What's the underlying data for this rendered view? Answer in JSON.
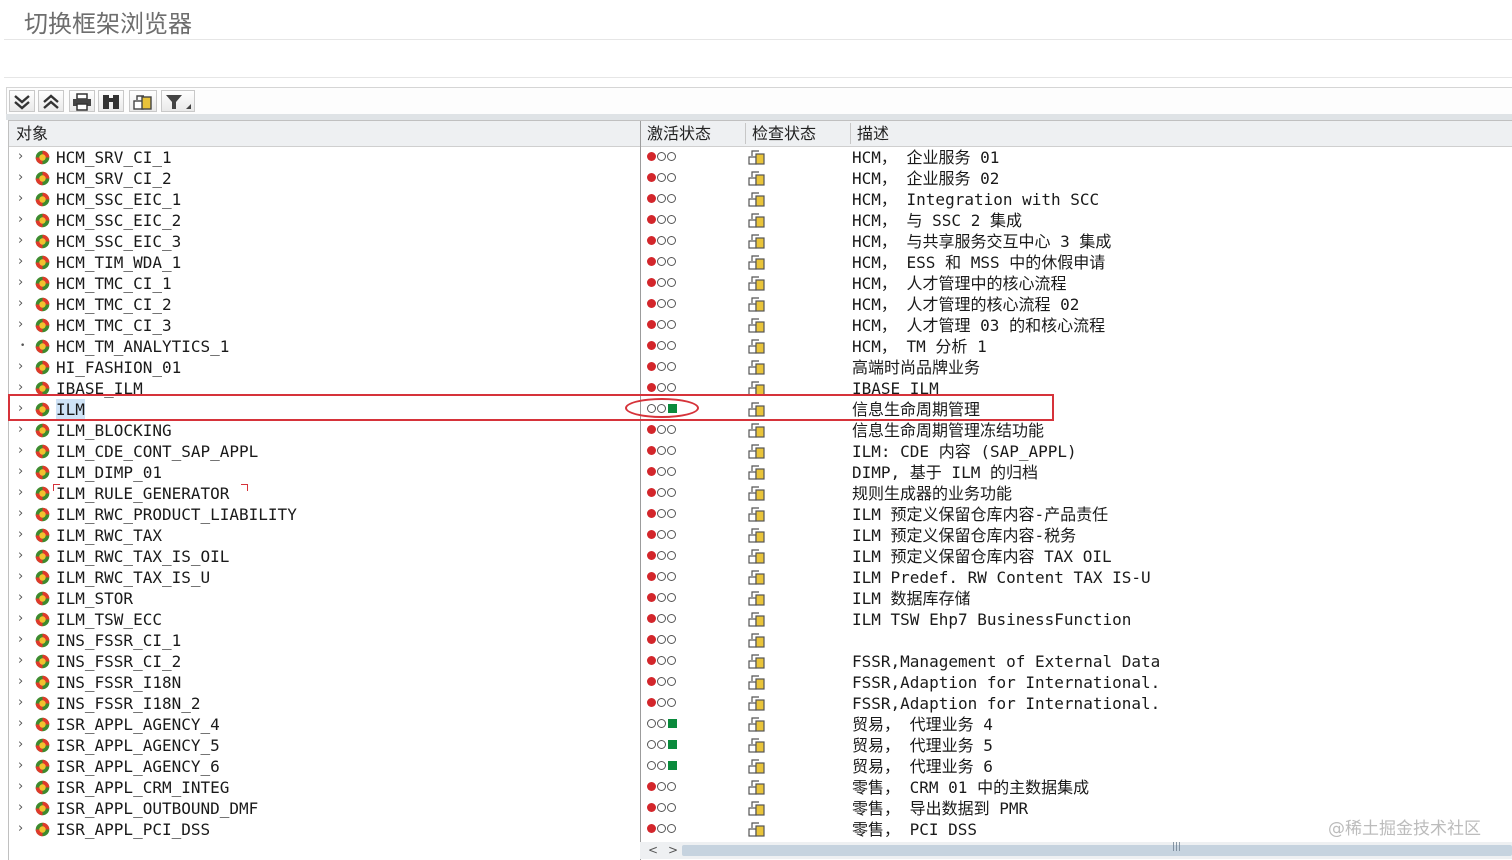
{
  "window": {
    "title": "切换框架浏览器"
  },
  "toolbar": {
    "buttons": [
      "expand-all-icon",
      "collapse-all-icon",
      "print-icon",
      "find-icon",
      "transport-icon",
      "filter-icon"
    ]
  },
  "columns": {
    "object": "对象",
    "activation": "激活状态",
    "check": "检查状态",
    "description": "描述"
  },
  "colors": {
    "inactive_red": "#d3262b",
    "active_green": "#0a8a3c",
    "highlight": "#d6333a",
    "selection": "#cfe3f6"
  },
  "rows": [
    {
      "name": "HCM_SRV_CI_1",
      "desc": "HCM， 企业服务 01",
      "active": false
    },
    {
      "name": "HCM_SRV_CI_2",
      "desc": "HCM， 企业服务 02",
      "active": false
    },
    {
      "name": "HCM_SSC_EIC_1",
      "desc": "HCM， Integration with SCC",
      "active": false
    },
    {
      "name": "HCM_SSC_EIC_2",
      "desc": "HCM， 与 SSC 2 集成",
      "active": false
    },
    {
      "name": "HCM_SSC_EIC_3",
      "desc": "HCM， 与共享服务交互中心 3 集成",
      "active": false
    },
    {
      "name": "HCM_TIM_WDA_1",
      "desc": "HCM， ESS 和 MSS 中的休假申请",
      "active": false
    },
    {
      "name": "HCM_TMC_CI_1",
      "desc": "HCM， 人才管理中的核心流程",
      "active": false
    },
    {
      "name": "HCM_TMC_CI_2",
      "desc": "HCM， 人才管理的核心流程 02",
      "active": false
    },
    {
      "name": "HCM_TMC_CI_3",
      "desc": "HCM， 人才管理 03 的和核心流程",
      "active": false
    },
    {
      "name": "HCM_TM_ANALYTICS_1",
      "desc": "HCM， TM 分析 1",
      "active": false,
      "leaf": true
    },
    {
      "name": "HI_FASHION_01",
      "desc": "高端时尚品牌业务",
      "active": false
    },
    {
      "name": "IBASE_ILM",
      "desc": "IBASE ILM",
      "active": false
    },
    {
      "name": "ILM",
      "desc": "信息生命周期管理",
      "active": true,
      "selected": true
    },
    {
      "name": "ILM_BLOCKING",
      "desc": "信息生命周期管理冻结功能",
      "active": false
    },
    {
      "name": "ILM_CDE_CONT_SAP_APPL",
      "desc": "ILM: CDE 内容 (SAP_APPL)",
      "active": false
    },
    {
      "name": "ILM_DIMP_01",
      "desc": "DIMP, 基于 ILM 的归档",
      "active": false
    },
    {
      "name": "ILM_RULE_GENERATOR",
      "desc": "规则生成器的业务功能",
      "active": false,
      "marked": true
    },
    {
      "name": "ILM_RWC_PRODUCT_LIABILITY",
      "desc": "ILM 预定义保留仓库内容-产品责任",
      "active": false
    },
    {
      "name": "ILM_RWC_TAX",
      "desc": "ILM 预定义保留仓库内容-税务",
      "active": false
    },
    {
      "name": "ILM_RWC_TAX_IS_OIL",
      "desc": "ILM 预定义保留仓库内容 TAX OIL",
      "active": false
    },
    {
      "name": "ILM_RWC_TAX_IS_U",
      "desc": "ILM Predef. RW Content TAX IS-U",
      "active": false
    },
    {
      "name": "ILM_STOR",
      "desc": "ILM 数据库存储",
      "active": false
    },
    {
      "name": "ILM_TSW_ECC",
      "desc": "ILM TSW Ehp7 BusinessFunction",
      "active": false
    },
    {
      "name": "INS_FSSR_CI_1",
      "desc": "",
      "active": false
    },
    {
      "name": "INS_FSSR_CI_2",
      "desc": "FSSR,Management of External Data",
      "active": false
    },
    {
      "name": "INS_FSSR_I18N",
      "desc": "FSSR,Adaption for International.",
      "active": false
    },
    {
      "name": "INS_FSSR_I18N_2",
      "desc": "FSSR,Adaption for International.",
      "active": false
    },
    {
      "name": "ISR_APPL_AGENCY_4",
      "desc": "贸易， 代理业务 4",
      "active": true
    },
    {
      "name": "ISR_APPL_AGENCY_5",
      "desc": "贸易， 代理业务 5",
      "active": true
    },
    {
      "name": "ISR_APPL_AGENCY_6",
      "desc": "贸易， 代理业务 6",
      "active": true
    },
    {
      "name": "ISR_APPL_CRM_INTEG",
      "desc": "零售， CRM 01 中的主数据集成",
      "active": false
    },
    {
      "name": "ISR_APPL_OUTBOUND_DMF",
      "desc": "零售， 导出数据到 PMR",
      "active": false
    },
    {
      "name": "ISR_APPL_PCI_DSS",
      "desc": "零售， PCI DSS",
      "active": false
    }
  ],
  "scrollbar": {
    "left": "<",
    "right": ">",
    "grip": "|||"
  },
  "watermark": "@稀土掘金技术社区"
}
